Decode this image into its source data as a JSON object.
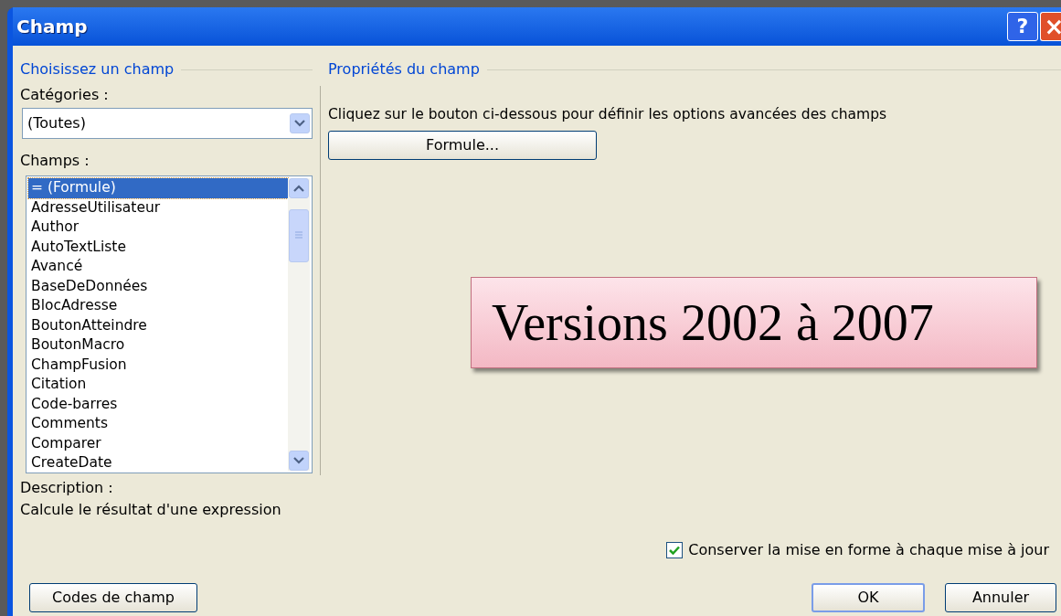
{
  "window": {
    "title": "Champ",
    "help_glyph": "?",
    "close_glyph": "×"
  },
  "left": {
    "heading": "Choisissez un champ",
    "categories_label": "Catégories :",
    "categories_value": "(Toutes)",
    "fields_label": "Champs :",
    "fields": [
      {
        "label": "= (Formule)",
        "selected": true
      },
      {
        "label": "AdresseUtilisateur",
        "selected": false
      },
      {
        "label": "Author",
        "selected": false
      },
      {
        "label": "AutoTextListe",
        "selected": false
      },
      {
        "label": "Avancé",
        "selected": false
      },
      {
        "label": "BaseDeDonnées",
        "selected": false
      },
      {
        "label": "BlocAdresse",
        "selected": false
      },
      {
        "label": "BoutonAtteindre",
        "selected": false
      },
      {
        "label": "BoutonMacro",
        "selected": false
      },
      {
        "label": "ChampFusion",
        "selected": false
      },
      {
        "label": "Citation",
        "selected": false
      },
      {
        "label": "Code-barres",
        "selected": false
      },
      {
        "label": "Comments",
        "selected": false
      },
      {
        "label": "Comparer",
        "selected": false
      },
      {
        "label": "CreateDate",
        "selected": false
      }
    ],
    "description_label": "Description :",
    "description": "Calcule le résultat d'une expression"
  },
  "right": {
    "heading": "Propriétés du champ",
    "instruction": "Cliquez sur le bouton ci-dessous pour définir les options avancées des champs",
    "formula_button": "Formule..."
  },
  "overlay_label": "Versions 2002 à 2007",
  "keep_format": {
    "label": "Conserver la mise en forme à chaque mise à jour",
    "checked": true
  },
  "buttons": {
    "field_codes": "Codes de champ",
    "ok": "OK",
    "cancel": "Annuler"
  }
}
